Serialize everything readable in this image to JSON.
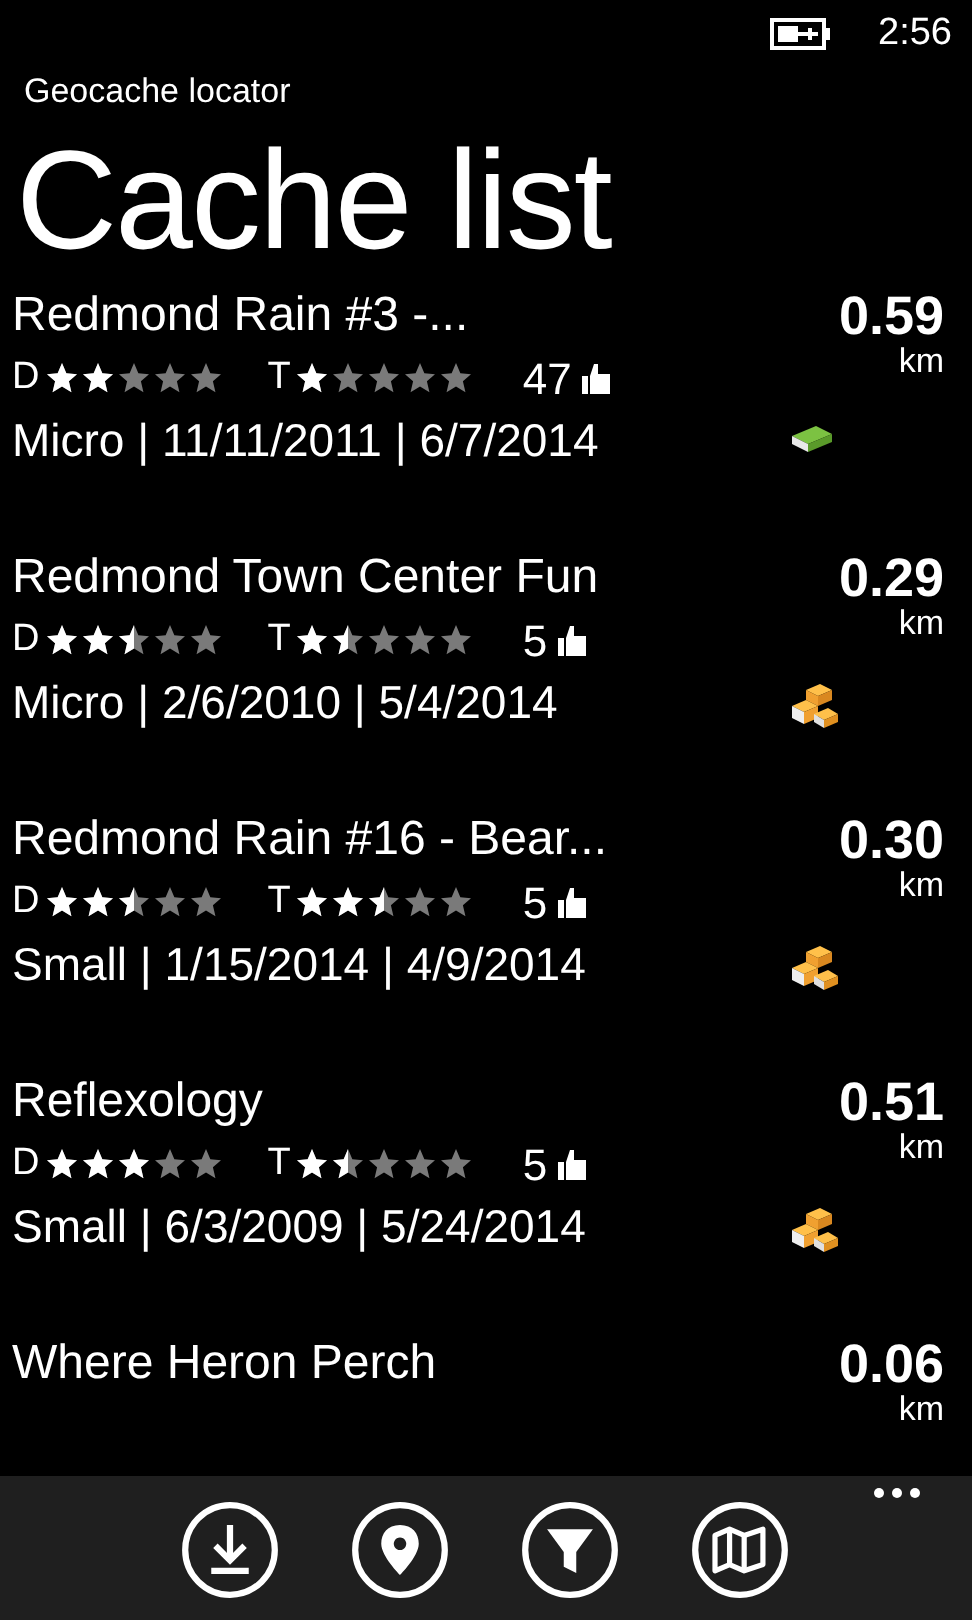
{
  "status_bar": {
    "time": "2:56"
  },
  "app_title": "Geocache locator",
  "page_title": "Cache list",
  "caches": [
    {
      "name": "Redmond Rain #3 -...",
      "difficulty": {
        "label": "D",
        "stars": 2
      },
      "terrain": {
        "label": "T",
        "stars": 1
      },
      "likes": "47",
      "details": "Micro | 11/11/2011 | 6/7/2014",
      "distance": "0.59",
      "unit": "km",
      "kind": "single"
    },
    {
      "name": "Redmond Town Center Fun",
      "difficulty": {
        "label": "D",
        "stars": 2.5
      },
      "terrain": {
        "label": "T",
        "stars": 1.5
      },
      "likes": "5",
      "details": "Micro | 2/6/2010 | 5/4/2014",
      "distance": "0.29",
      "unit": "km",
      "kind": "multi"
    },
    {
      "name": "Redmond Rain #16 - Bear...",
      "difficulty": {
        "label": "D",
        "stars": 2.5
      },
      "terrain": {
        "label": "T",
        "stars": 2.5
      },
      "likes": "5",
      "details": "Small | 1/15/2014 | 4/9/2014",
      "distance": "0.30",
      "unit": "km",
      "kind": "multi"
    },
    {
      "name": "Reflexology",
      "difficulty": {
        "label": "D",
        "stars": 3
      },
      "terrain": {
        "label": "T",
        "stars": 1.5
      },
      "likes": "5",
      "details": "Small | 6/3/2009 | 5/24/2014",
      "distance": "0.51",
      "unit": "km",
      "kind": "multi"
    },
    {
      "name": "Where Heron Perch",
      "distance": "0.06",
      "unit": "km"
    }
  ],
  "app_bar": {
    "buttons": [
      {
        "kind": "download"
      },
      {
        "kind": "location"
      },
      {
        "kind": "filter"
      },
      {
        "kind": "map"
      }
    ]
  }
}
